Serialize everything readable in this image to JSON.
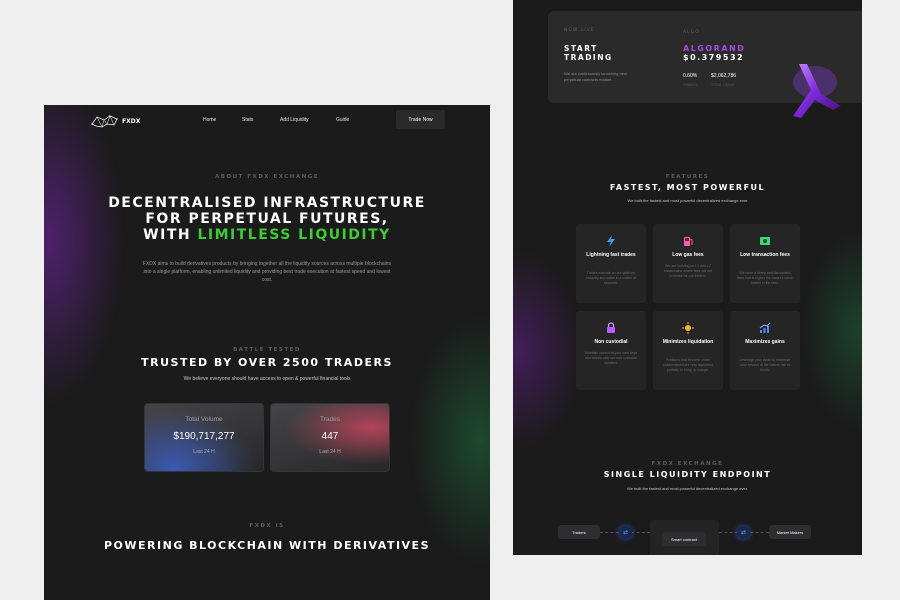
{
  "left": {
    "brand": "FXDX",
    "nav": [
      "Home",
      "Stats",
      "Add Liquidity",
      "Guide"
    ],
    "trade_button": "Trade Now",
    "about_eyebrow": "ABOUT FXDX EXCHANGE",
    "hero_line1": "DECENTRALISED INFRASTRUCTURE",
    "hero_line2": "FOR PERPETUAL FUTURES,",
    "hero_line3_prefix": "WITH ",
    "hero_line3_highlight": "LIMITLESS LIQUIDITY",
    "hero_paragraph": "FXDX aims to build derivatives products by bringing together all the liquidity sources across multiple blockchains into a single platform, enabling unlimited liquidity and providing best trade execution at fastest speed and lowest cost.",
    "battle_eyebrow": "BATTLE TESTED",
    "trusted_heading": "TRUSTED BY OVER 2500 TRADERS",
    "trusted_sub": "We believe everyone should have access to open & powerful financial tools",
    "stats": [
      {
        "title": "Total Volume",
        "value": "$190,717,277",
        "label": "Last 24 H"
      },
      {
        "title": "Trades",
        "value": "447",
        "label": "Last 24 H"
      }
    ],
    "fxdx_is_eyebrow": "FXDX IS",
    "powering_heading": "POWERING BLOCKCHAIN WITH DERIVATIVES"
  },
  "right": {
    "live": {
      "eyebrow": "NOW LIVE",
      "heading1": "START",
      "heading2": "TRADING",
      "desc": "We are continuously launching new perpetual contracts market.",
      "algo_eyebrow": "ALGO",
      "algo_name": "ALGORAND",
      "algo_price": "$0.379532",
      "metric1_value": "0.60%",
      "metric1_label": "CHANGE",
      "metric2_value": "$2,062,786",
      "metric2_label": "TOTAL LIQUID"
    },
    "features_eyebrow": "FEATURES",
    "features_heading": "FASTEST, MOST POWERFUL",
    "features_sub": "We built the fastest and most powerful decentralized exchange ever",
    "cards": [
      {
        "title": "Lightning fast trades",
        "desc": "Trades execute on our platform instantly and settle in a matter of seconds.",
        "icon": "lightning-icon",
        "color": "#3d9bff"
      },
      {
        "title": "Low gas fees",
        "desc": "We are building on L1 and L2 blockchains where fees will not increase for our traders.",
        "icon": "gas-pump-icon",
        "color": "#ff5fa8"
      },
      {
        "title": "Low transaction fees",
        "desc": "We have a tiered and discounted fees that is higher the trader's value traded in the fees.",
        "icon": "money-icon",
        "color": "#3fd67a"
      },
      {
        "title": "Non custodial",
        "desc": "Maintain control of your own keys and assets with our non custodial solution.",
        "icon": "lock-icon",
        "color": "#b85cff"
      },
      {
        "title": "Minimizes liquidation",
        "desc": "Positions that become under collateralized are only liquidated partially to bring up margin.",
        "icon": "sun-icon",
        "color": "#ffb22e"
      },
      {
        "title": "Maximizes gains",
        "desc": "Leverage your trade to maximize your returns at the lowest risk of funds.",
        "icon": "chart-up-icon",
        "color": "#4d8cff"
      }
    ],
    "endpoint_eyebrow": "FXDX EXCHANGE",
    "endpoint_heading": "SINGLE LIQUIDITY ENDPOINT",
    "endpoint_sub": "We built the fastest and most powerful decentralized exchange ever.",
    "flow": {
      "traders": "Traders",
      "contract": "Smart contract",
      "makers": "Market Makers"
    }
  }
}
